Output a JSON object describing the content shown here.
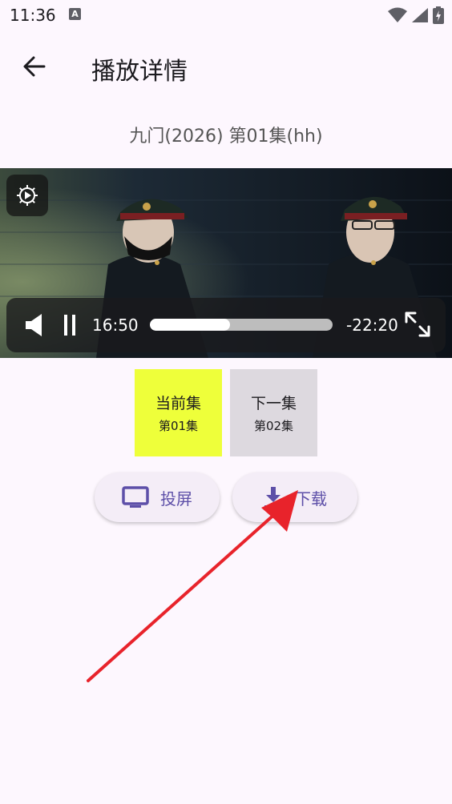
{
  "status_bar": {
    "time": "11:36",
    "notification_icon": "A"
  },
  "header": {
    "title": "播放详情",
    "back_icon": "arrow-left-icon"
  },
  "video": {
    "title": "九门(2026) 第01集(hh)",
    "current_time": "16:50",
    "remaining_time": "-22:20",
    "progress": 0.44
  },
  "episodes": [
    {
      "title": "当前集",
      "subtitle": "第01集",
      "color": "#EEFF3A"
    },
    {
      "title": "下一集",
      "subtitle": "第02集",
      "color": "#DDD9DF"
    }
  ],
  "actions": {
    "cast_label": "投屏",
    "download_label": "下载"
  },
  "colors": {
    "background": "#FDF7FE",
    "accent": "#5D4FA8",
    "annotation": "#E8232B"
  }
}
